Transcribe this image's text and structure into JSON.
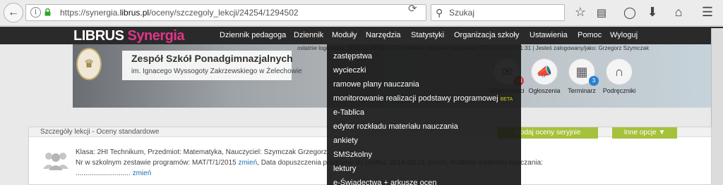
{
  "browser": {
    "url_prefix": "https://synergia.",
    "url_domain": "librus.pl",
    "url_path": "/oceny/szczegoly_lekcji/24254/1294502",
    "search_placeholder": "Szukaj"
  },
  "site": {
    "logo_part1": "LIBRUS",
    "logo_part2": " Synergia",
    "nav": [
      "Dziennik pedagoga",
      "Dziennik",
      "Moduły",
      "Narzędzia",
      "Statystyki",
      "Organizacja szkoły",
      "Ustawienia",
      "Pomoc",
      "Wyloguj"
    ]
  },
  "header": {
    "school_name": "Zespół Szkół Ponadgimnazjalnych",
    "school_sub": "im. Ignacego Wyssogoty Zakrzewskiego w Żelechowie",
    "login_info": "ostatnie logowanie: 2016-10-20 08:53:22  |  ostatnie nieudane logowanie: 2016-10-20 14:11:31  |  Jesteś zalogowany/jako: Grzegorz Szymczak",
    "modules": [
      {
        "label": "Wiadomości",
        "badge": "14"
      },
      {
        "label": "Ogłoszenia",
        "badge": ""
      },
      {
        "label": "Terminarz",
        "badge": "3"
      },
      {
        "label": "Podręczniki",
        "badge": ""
      }
    ]
  },
  "panel": {
    "title": "Szczegóły lekcji - Oceny standardowe",
    "btn_serial": "Dodaj oceny seryjnie",
    "btn_more": "Inne opcje ▼",
    "line1": "Klasa: 2HI Technikum, Przedmiot: Matematyka, Nauczyciel: Szymczak Grzegorz",
    "line2a": "Nr w szkolnym zestawie programów: MAT/T/1/2015",
    "link_change": "zmień",
    "line2b": ", Data dopuszczenia programu do użytku: 2016-09-01",
    "line2c": ", Rozkład materiału nauczania:",
    "line3": "............................",
    "link_change3": "zmień"
  },
  "dropdown": {
    "items": [
      "zastępstwa",
      "wycieczki",
      "ramowe plany nauczania",
      "monitorowanie realizacji podstawy programowej",
      "e-Tablica",
      "edytor rozkładu materiału nauczania",
      "ankiety",
      "SMSzkolny",
      "lektury",
      "e-Świadectwa + arkusze ocen"
    ],
    "beta_label": "BETA"
  }
}
